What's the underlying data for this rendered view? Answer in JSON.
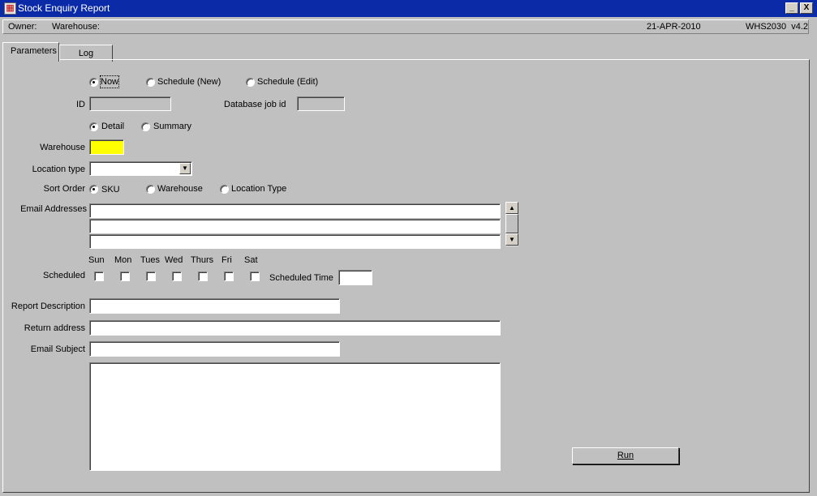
{
  "window": {
    "title": "Stock Enquiry Report",
    "icon": "report-app-icon",
    "minimize_glyph": "_",
    "close_glyph": "X"
  },
  "infobar": {
    "owner_label": "Owner:",
    "warehouse_label": "Warehouse:",
    "date": "21-APR-2010",
    "version": "WHS2030  v4.2"
  },
  "tabs": [
    {
      "label": "Parameters",
      "active": true
    },
    {
      "label": "Log",
      "active": false
    }
  ],
  "run_mode": {
    "options": [
      "Now",
      "Schedule (New)",
      "Schedule (Edit)"
    ],
    "selected": "Now"
  },
  "id_label": "ID",
  "id_value": "",
  "database_job_id_label": "Database job id",
  "database_job_id_value": "",
  "report_type": {
    "options": [
      "Detail",
      "Summary"
    ],
    "selected": "Detail"
  },
  "warehouse_label": "Warehouse",
  "warehouse_value": "",
  "location_type_label": "Location type",
  "location_type_value": "",
  "sort_order": {
    "label": "Sort Order",
    "options": [
      "SKU",
      "Warehouse",
      "Location Type"
    ],
    "selected": "SKU"
  },
  "email_addresses_label": "Email Addresses",
  "email_addresses": [
    "",
    "",
    ""
  ],
  "days": [
    "Sun",
    "Mon",
    "Tues",
    "Wed",
    "Thurs",
    "Fri",
    "Sat"
  ],
  "scheduled_label": "Scheduled",
  "scheduled_time_label": "Scheduled Time",
  "scheduled_time_value": "",
  "report_description_label": "Report Description",
  "report_description_value": "",
  "return_address_label": "Return address",
  "return_address_value": "",
  "email_subject_label": "Email Subject",
  "email_subject_value": "",
  "email_body_value": "",
  "run_button_label": "Run",
  "colors": {
    "titlebar": "#0a2aa8",
    "background": "#c0c0c0",
    "required_field": "#ffff00"
  }
}
